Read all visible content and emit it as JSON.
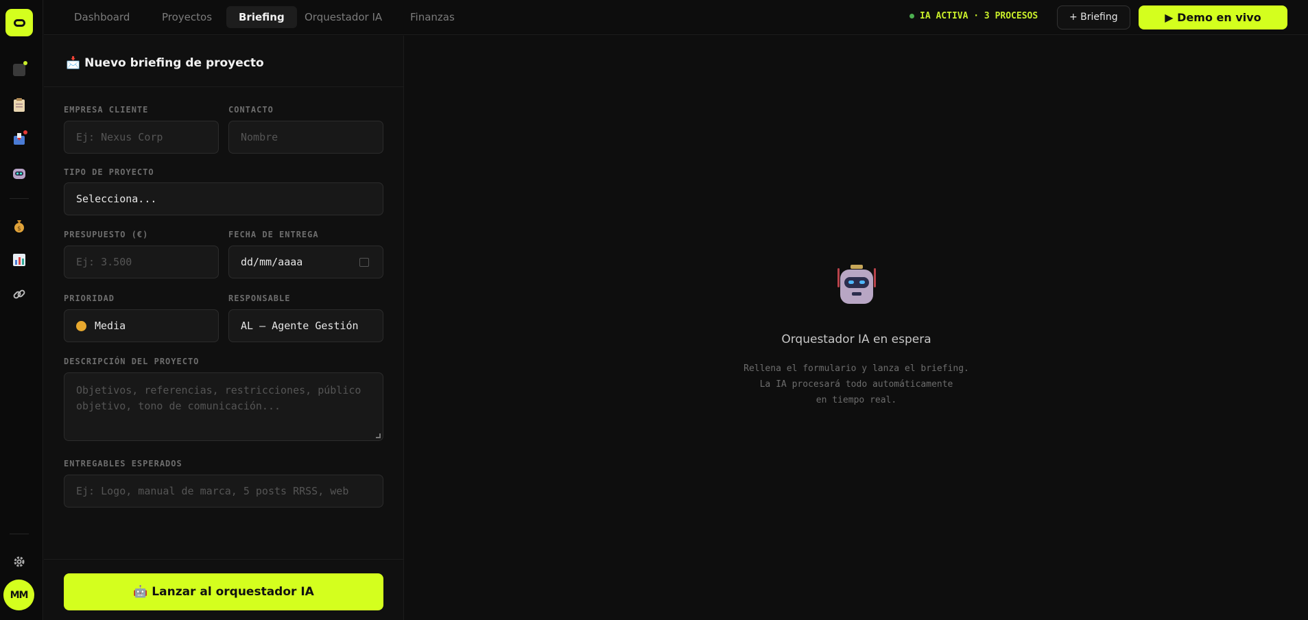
{
  "nav": {
    "tabs": [
      {
        "label": "Dashboard",
        "active": false
      },
      {
        "label": "Proyectos",
        "active": false
      },
      {
        "label": "Briefing",
        "active": true
      },
      {
        "label": "Orquestador IA",
        "active": false
      },
      {
        "label": "Finanzas",
        "active": false
      }
    ],
    "status": "IA ACTIVA · 3 PROCESOS",
    "new_briefing": "+ Briefing",
    "demo": "▶ Demo en vivo"
  },
  "sidebar": {
    "icons": [
      "square-icon",
      "clipboard-icon",
      "inbox-icon",
      "robot-icon",
      "money-bag-icon",
      "bar-chart-icon",
      "link-icon",
      "gear-icon"
    ],
    "avatar": "MM"
  },
  "form": {
    "title_icon": "📩",
    "title": "Nuevo briefing de proyecto",
    "empresa": {
      "label": "EMPRESA CLIENTE",
      "placeholder": "Ej: Nexus Corp"
    },
    "contacto": {
      "label": "CONTACTO",
      "placeholder": "Nombre"
    },
    "tipo": {
      "label": "TIPO DE PROYECTO",
      "value": "Selecciona..."
    },
    "presupuesto": {
      "label": "PRESUPUESTO (€)",
      "placeholder": "Ej: 3.500"
    },
    "fecha": {
      "label": "FECHA DE ENTREGA",
      "value": "dd/mm/aaaa"
    },
    "prioridad": {
      "label": "PRIORIDAD",
      "value": "Media"
    },
    "responsable": {
      "label": "RESPONSABLE",
      "value": "AL — Agente Gestión"
    },
    "descripcion": {
      "label": "DESCRIPCIÓN DEL PROYECTO",
      "placeholder": "Objetivos, referencias, restricciones, público objetivo, tono de comunicación..."
    },
    "entregables": {
      "label": "ENTREGABLES ESPERADOS",
      "placeholder": "Ej: Logo, manual de marca, 5 posts RRSS, web"
    },
    "launch": "🤖 Lanzar al orquestador IA"
  },
  "stage": {
    "title": "Orquestador IA en espera",
    "desc": [
      "Rellena el formulario y lanza el briefing.",
      "La IA procesará todo automáticamente",
      "en tiempo real."
    ]
  },
  "colors": {
    "accent": "#d4ff1e",
    "status_dot": "#4caf50",
    "priority": "#e7a82e"
  }
}
